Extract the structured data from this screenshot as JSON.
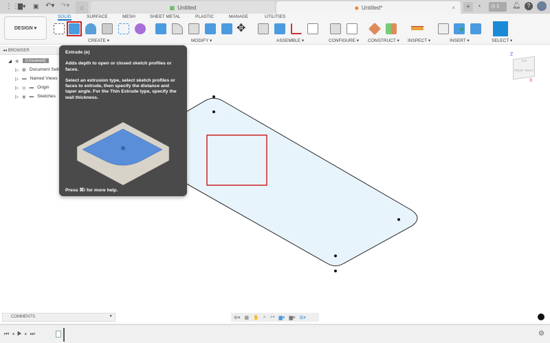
{
  "tabs": [
    {
      "label": "Untitled",
      "active": false
    },
    {
      "label": "Untitled*",
      "active": true
    }
  ],
  "header_badge": "1",
  "toolbar": {
    "workspace": "DESIGN ▾",
    "tabs": [
      "SOLID",
      "SURFACE",
      "MESH",
      "SHEET METAL",
      "PLASTIC",
      "MANAGE",
      "UTILITIES"
    ],
    "active_tab": "SOLID",
    "groups": [
      "CREATE ▾",
      "MODIFY ▾",
      "ASSEMBLE ▾",
      "CONFIGURE ▾",
      "CONSTRUCT ▾",
      "INSPECT ▾",
      "INSERT ▾",
      "SELECT ▾"
    ]
  },
  "browser": {
    "title": "BROWSER",
    "items": [
      "(Unsaved)",
      "Document Settings",
      "Named Views",
      "Origin",
      "Sketches"
    ]
  },
  "tooltip": {
    "title": "Extrude (e)",
    "desc": "Adds depth to open or closed sketch profiles or faces.",
    "detail": "Select an extrusion type, select sketch profiles or faces to extrude, then specify the distance and taper angle. For the Thin Extrude type, specify the wall thickness.",
    "footer": "Press ⌘/ for more help."
  },
  "viewcube": {
    "top": "TOP",
    "front": "FRONT",
    "right": "RIGHT",
    "axis_z": "Z",
    "axis_x": "X"
  },
  "comments": {
    "label": "COMMENTS"
  },
  "colors": {
    "accent": "#1a73c8",
    "selection": "#cc2222",
    "sketch_fill": "#e8f4fc",
    "tooltip_bg": "#4a4a4a"
  }
}
